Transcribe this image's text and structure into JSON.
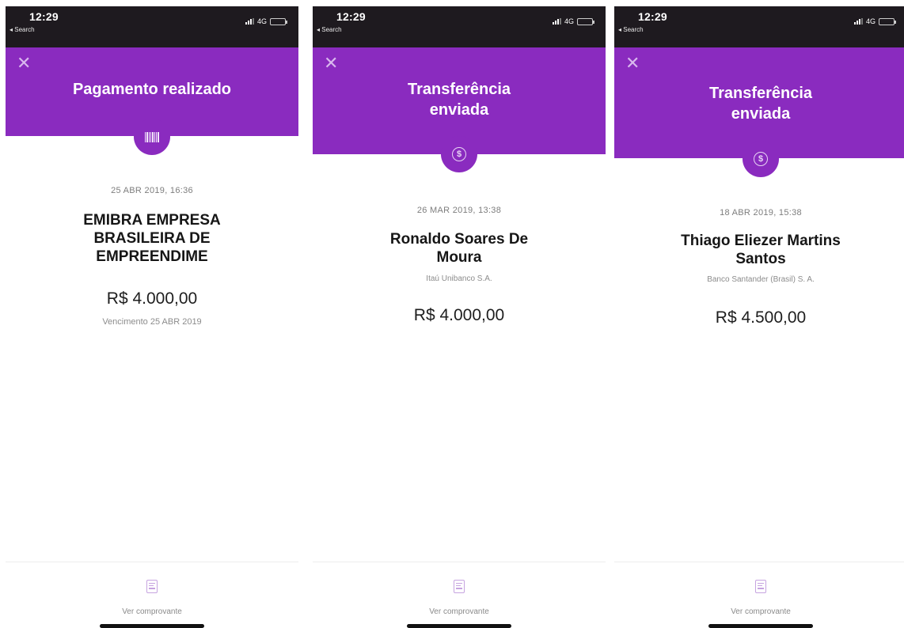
{
  "status_bar": {
    "time": "12:29",
    "back_label": "◂ Search",
    "network": "4G"
  },
  "screens": [
    {
      "header_title": "Pagamento realizado",
      "icon": "barcode-icon",
      "date": "25 ABR 2019, 16:36",
      "name": "EMIBRA EMPRESA BRASILEIRA DE EMPREENDIME",
      "bank": "",
      "amount": "R$ 4.000,00",
      "due": "Vencimento 25 ABR 2019",
      "receipt_label": "Ver comprovante"
    },
    {
      "header_title": "Transferência enviada",
      "icon": "dollar-circle-icon",
      "date": "26 MAR 2019, 13:38",
      "name": "Ronaldo Soares De Moura",
      "bank": "Itaú Unibanco S.A.",
      "amount": "R$ 4.000,00",
      "due": "",
      "receipt_label": "Ver comprovante"
    },
    {
      "header_title": "Transferência enviada",
      "icon": "dollar-circle-icon",
      "date": "18 ABR 2019, 15:38",
      "name": "Thiago Eliezer Martins Santos",
      "bank": "Banco Santander (Brasil) S. A.",
      "amount": "R$ 4.500,00",
      "due": "",
      "receipt_label": "Ver comprovante"
    }
  ],
  "colors": {
    "header_purple": "#8a2bbf",
    "status_bar": "#1e1a1f"
  }
}
